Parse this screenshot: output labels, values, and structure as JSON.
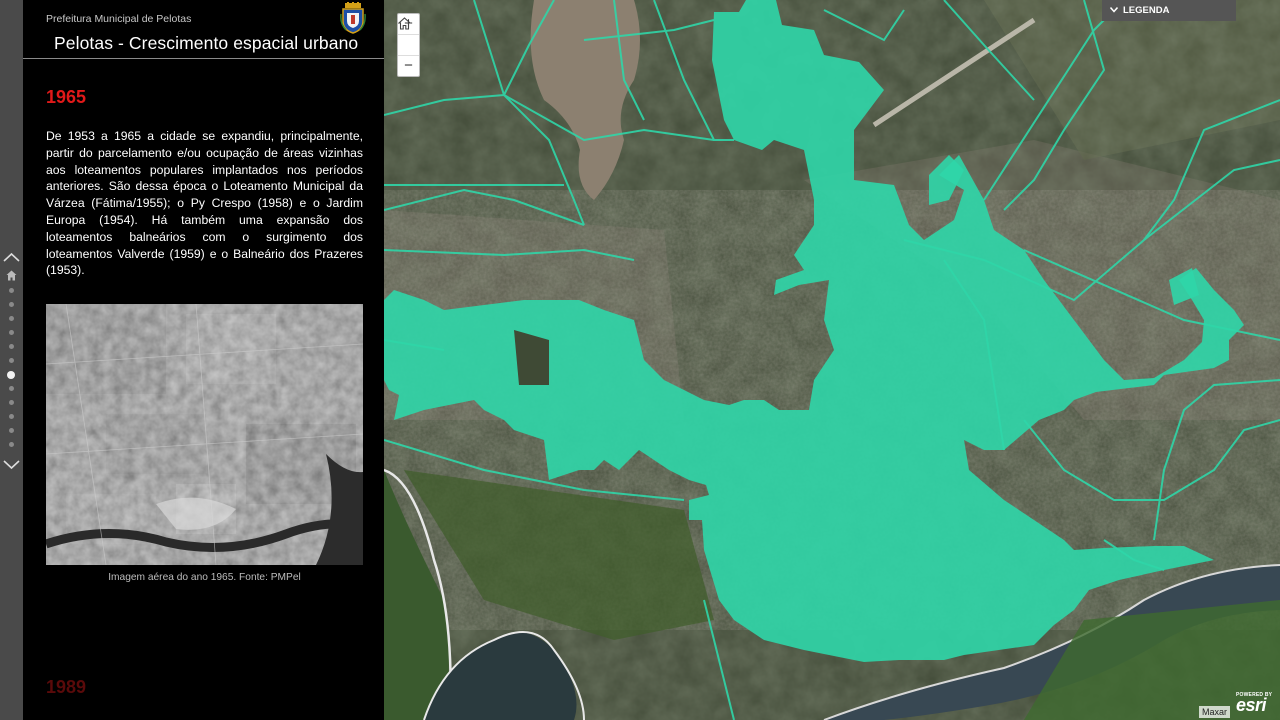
{
  "header": {
    "organization": "Prefeitura Municipal de Pelotas",
    "title": "Pelotas - Crescimento espacial urbano"
  },
  "section": {
    "year": "1965",
    "paragraph": "De 1953 a 1965 a cidade se expandiu, principalmente, partir do parcelamento e/ou ocupação de áreas vizinhas aos loteamentos populares implantados nos períodos anteriores. São dessa época o Loteamento Municipal da Várzea (Fátima/1955); o Py Crespo (1958) e o Jardim Europa (1954). Há também uma expansão dos loteamentos balneários com o surgimento dos loteamentos Valverde (1959) e o Balneário dos Prazeres (1953).",
    "image_caption": "Imagem aérea do ano 1965. Fonte: PMPel",
    "next_year": "1989"
  },
  "nav": {
    "up_icon": "chevron-up-icon",
    "home_icon": "home-icon",
    "down_icon": "chevron-down-icon",
    "active_index": 6
  },
  "map": {
    "zoom_in": "+",
    "zoom_out": "−",
    "home_icon": "home-icon",
    "legend_label": "LEGENDA",
    "powered_by": "POWERED BY",
    "esri_logo": "esri",
    "attribution": "Maxar",
    "urban_area_color": "#2fd6a8",
    "road_color": "#2fd6a8"
  }
}
